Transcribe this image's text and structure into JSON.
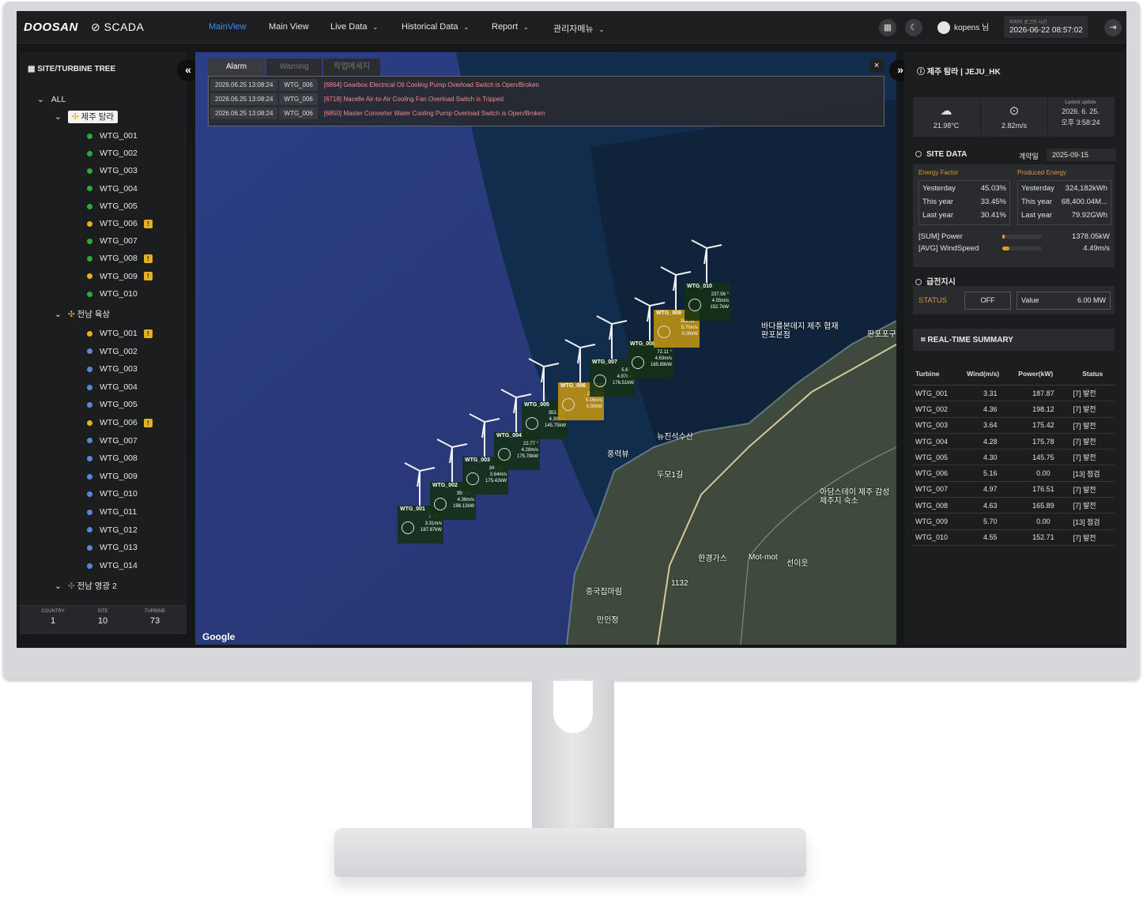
{
  "header": {
    "logo_brand": "DOOSAN",
    "logo_product": "SCADA",
    "nav": [
      {
        "label": "MainView",
        "active": true,
        "dropdown": false
      },
      {
        "label": "Main View",
        "active": false,
        "dropdown": false
      },
      {
        "label": "Live Data",
        "active": false,
        "dropdown": true
      },
      {
        "label": "Historical Data",
        "active": false,
        "dropdown": true
      },
      {
        "label": "Report",
        "active": false,
        "dropdown": true
      },
      {
        "label": "관리자메뉴",
        "active": false,
        "dropdown": true
      }
    ],
    "user": "kopens 님",
    "last_login_label": "마지막 로그인 시간",
    "last_login_time": "2026-06-22 08:57:02"
  },
  "left_panel": {
    "title": "SITE/TURBINE TREE",
    "root": "ALL",
    "sites": [
      {
        "name": "제주 탐라",
        "selected": true,
        "turbines": [
          {
            "id": "WTG_001",
            "status": "green",
            "warn": false
          },
          {
            "id": "WTG_002",
            "status": "green",
            "warn": false
          },
          {
            "id": "WTG_003",
            "status": "green",
            "warn": false
          },
          {
            "id": "WTG_004",
            "status": "green",
            "warn": false
          },
          {
            "id": "WTG_005",
            "status": "green",
            "warn": false
          },
          {
            "id": "WTG_006",
            "status": "yellow",
            "warn": true
          },
          {
            "id": "WTG_007",
            "status": "green",
            "warn": false
          },
          {
            "id": "WTG_008",
            "status": "green",
            "warn": true
          },
          {
            "id": "WTG_009",
            "status": "yellow",
            "warn": true
          },
          {
            "id": "WTG_010",
            "status": "green",
            "warn": false
          }
        ]
      },
      {
        "name": "전남 육상",
        "selected": false,
        "turbines": [
          {
            "id": "WTG_001",
            "status": "yellow",
            "warn": true
          },
          {
            "id": "WTG_002",
            "status": "blue",
            "warn": false
          },
          {
            "id": "WTG_003",
            "status": "blue",
            "warn": false
          },
          {
            "id": "WTG_004",
            "status": "blue",
            "warn": false
          },
          {
            "id": "WTG_005",
            "status": "blue",
            "warn": false
          },
          {
            "id": "WTG_006",
            "status": "yellow",
            "warn": true
          },
          {
            "id": "WTG_007",
            "status": "blue",
            "warn": false
          },
          {
            "id": "WTG_008",
            "status": "blue",
            "warn": false
          },
          {
            "id": "WTG_009",
            "status": "blue",
            "warn": false
          },
          {
            "id": "WTG_010",
            "status": "blue",
            "warn": false
          },
          {
            "id": "WTG_011",
            "status": "blue",
            "warn": false
          },
          {
            "id": "WTG_012",
            "status": "blue",
            "warn": false
          },
          {
            "id": "WTG_013",
            "status": "blue",
            "warn": false
          },
          {
            "id": "WTG_014",
            "status": "blue",
            "warn": false
          }
        ]
      },
      {
        "name": "전남 영광 2",
        "selected": false,
        "turbines": []
      }
    ],
    "stats": {
      "country_label": "COUNTRY",
      "country": "1",
      "site_label": "SITE",
      "site": "10",
      "turbine_label": "TURBINE",
      "turbine": "73"
    }
  },
  "alarm_panel": {
    "tabs": [
      "Alarm",
      "Warning",
      "작업메세지"
    ],
    "close": "×",
    "rows": [
      {
        "time": "2026.06.25 13:08:24",
        "wtg": "WTG_006",
        "msg": "[6864] Gearbox Electrical Oil Cooling Pump Overload Switch is Open/Broken"
      },
      {
        "time": "2026.06.25 13:08:24",
        "wtg": "WTG_006",
        "msg": "[6718] Nacelle Air-to-Air Cooling Fan Overload Switch is Tripped"
      },
      {
        "time": "2026.06.25 13:08:24",
        "wtg": "WTG_006",
        "msg": "[6850] Master Converter Water Cooling Pump Overload Switch is Open/Broken"
      }
    ]
  },
  "map": {
    "attribution": "Google",
    "places": [
      "바다를본데지 제주 협재판포본점",
      "판포포구",
      "뉴진석수산",
      "풍력뷰",
      "두모1길",
      "아담스테이 제주 감성제주지 숙소",
      "한경가스",
      "Mot-mot",
      "선이웃",
      "중국집마림",
      "만인정",
      "1132"
    ],
    "turbines": [
      {
        "id": "WTG_001",
        "dir": "0.97 °",
        "wind": "3.31m/s",
        "power": "187.87kW",
        "warn": false
      },
      {
        "id": "WTG_002",
        "dir": "359.04 °",
        "wind": "4.36m/s",
        "power": "198.12kW",
        "warn": false
      },
      {
        "id": "WTG_003",
        "dir": "341.53 °",
        "wind": "3.64m/s",
        "power": "175.42kW",
        "warn": false
      },
      {
        "id": "WTG_004",
        "dir": "22.77 °",
        "wind": "4.28m/s",
        "power": "175.78kW",
        "warn": false
      },
      {
        "id": "WTG_005",
        "dir": "353.75 °",
        "wind": "4.30m/s",
        "power": "145.75kW",
        "warn": false
      },
      {
        "id": "WTG_006",
        "dir": "21.56 °",
        "wind": "5.16m/s",
        "power": "0.00kW",
        "warn": true
      },
      {
        "id": "WTG_007",
        "dir": "5.66 °",
        "wind": "4.97m/s",
        "power": "176.51kW",
        "warn": false
      },
      {
        "id": "WTG_008",
        "dir": "72.11 °",
        "wind": "4.63m/s",
        "power": "165.89kW",
        "warn": false
      },
      {
        "id": "WTG_009",
        "dir": "189.31 °",
        "wind": "5.70m/s",
        "power": "0.00kW",
        "warn": true
      },
      {
        "id": "WTG_010",
        "dir": "237.56 °",
        "wind": "4.55m/s",
        "power": "152.7kW",
        "warn": false
      }
    ]
  },
  "right_panel": {
    "title": "제주 탐라 | JEJU_HK",
    "weather": {
      "temp": "21.98°C",
      "wind": "2.82m/s",
      "update_label": "Lastest update",
      "update_date": "2026. 6. 25.",
      "update_time": "오후 3:58:24"
    },
    "site_data": {
      "title": "SITE DATA",
      "contract_label": "계약일",
      "contract_date": "2025-09-15",
      "energy_factor_label": "Energy Factor",
      "produced_energy_label": "Produced Energy",
      "energy_factor": [
        {
          "k": "Yesterday",
          "v": "45.03%"
        },
        {
          "k": "This year",
          "v": "33.45%"
        },
        {
          "k": "Last year",
          "v": "30.41%"
        }
      ],
      "produced_energy": [
        {
          "k": "Yesterday",
          "v": "324,182kWh"
        },
        {
          "k": "This year",
          "v": "68,400.04M..."
        },
        {
          "k": "Last year",
          "v": "79.92GWh"
        }
      ],
      "sum_power_label": "[SUM] Power",
      "sum_power": "1378.05kW",
      "sum_power_fraction": 0.05,
      "avg_wind_label": "[AVG] WindSpeed",
      "avg_wind": "4.49m/s",
      "avg_wind_fraction": 0.18
    },
    "dispatch": {
      "title": "급전지시",
      "status_label": "STATUS",
      "status": "OFF",
      "value_label": "Value",
      "value": "6.00 MW"
    },
    "summary": {
      "title": "REAL-TIME SUMMARY",
      "columns": [
        "Turbine",
        "Wind(m/s)",
        "Power(kW)",
        "Status"
      ],
      "rows": [
        {
          "turbine": "WTG_001",
          "wind": "3.31",
          "power": "187.87",
          "status": "[7] 발전",
          "ok": true
        },
        {
          "turbine": "WTG_002",
          "wind": "4.36",
          "power": "198.12",
          "status": "[7] 발전",
          "ok": true
        },
        {
          "turbine": "WTG_003",
          "wind": "3.64",
          "power": "175.42",
          "status": "[7] 발전",
          "ok": true
        },
        {
          "turbine": "WTG_004",
          "wind": "4.28",
          "power": "175.78",
          "status": "[7] 발전",
          "ok": true
        },
        {
          "turbine": "WTG_005",
          "wind": "4.30",
          "power": "145.75",
          "status": "[7] 발전",
          "ok": true
        },
        {
          "turbine": "WTG_006",
          "wind": "5.16",
          "power": "0.00",
          "status": "[13] 점검",
          "ok": false
        },
        {
          "turbine": "WTG_007",
          "wind": "4.97",
          "power": "176.51",
          "status": "[7] 발전",
          "ok": true
        },
        {
          "turbine": "WTG_008",
          "wind": "4.63",
          "power": "165.89",
          "status": "[7] 발전",
          "ok": true
        },
        {
          "turbine": "WTG_009",
          "wind": "5.70",
          "power": "0.00",
          "status": "[13] 점검",
          "ok": false
        },
        {
          "turbine": "WTG_010",
          "wind": "4.55",
          "power": "152.71",
          "status": "[7] 발전",
          "ok": true
        }
      ]
    }
  },
  "colors": {
    "accent": "#3b8dff",
    "ok": "#3fbf56",
    "warn": "#e5b123",
    "offline": "#5a86d8",
    "check": "#f2d027"
  }
}
